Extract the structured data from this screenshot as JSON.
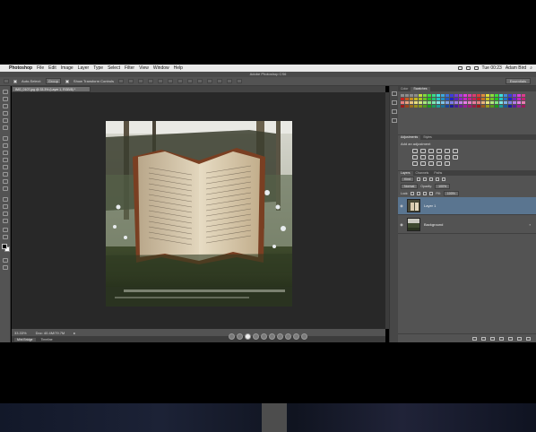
{
  "menubar": {
    "app": "Photoshop",
    "items": [
      "File",
      "Edit",
      "Image",
      "Layer",
      "Type",
      "Select",
      "Filter",
      "View",
      "Window",
      "Help"
    ],
    "clock": "Tue 00:23",
    "user": "Adam Bird"
  },
  "window": {
    "title": "Adobe Photoshop CS6"
  },
  "options": {
    "auto_select_label": "Auto-Select:",
    "auto_select_value": "Group",
    "show_transform_label": "Show Transform Controls",
    "workspace": "Essentials"
  },
  "document": {
    "tab_label": "IMG_0107.jpg @ 33.3% (Layer 1, RGB/8) *",
    "status_zoom": "33.33%",
    "status_doc": "Doc: 40.4M/79.7M"
  },
  "bottom_tabs": [
    "Mini Bridge",
    "Timeline"
  ],
  "panels": {
    "top_tabs": [
      "Color",
      "Swatches"
    ],
    "adj_tabs": [
      "Adjustments",
      "Styles"
    ],
    "adj_title": "Add an adjustment",
    "layer_tabs": [
      "Layers",
      "Channels",
      "Paths"
    ],
    "kind_label": "Kind",
    "blend_mode": "Normal",
    "opacity_label": "Opacity:",
    "opacity_value": "100%",
    "lock_label": "Lock:",
    "fill_label": "Fill:",
    "fill_value": "100%",
    "layers": [
      {
        "name": "Layer 1"
      },
      {
        "name": "Background"
      }
    ]
  },
  "colors": {
    "accent_selection": "#5a7590",
    "panel_bg": "#535353"
  }
}
